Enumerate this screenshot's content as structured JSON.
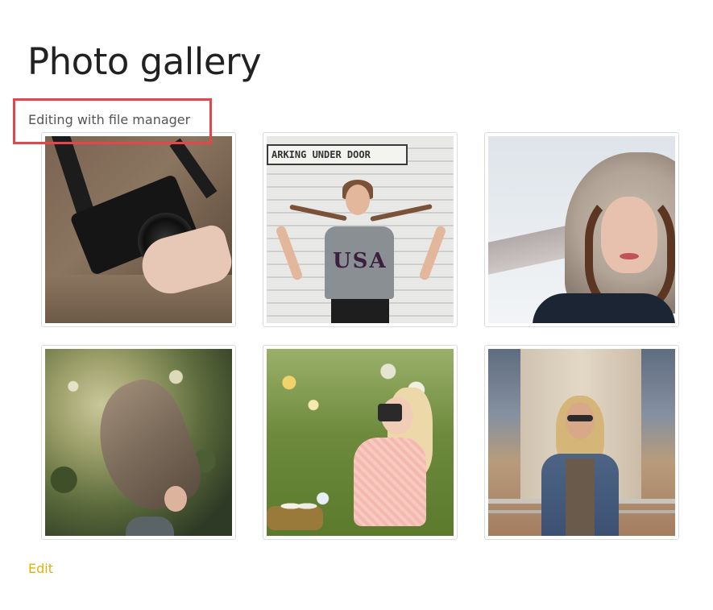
{
  "page": {
    "title": "Photo gallery",
    "subtitle": "Editing with file manager"
  },
  "gallery": {
    "photos": [
      {
        "name": "photo-camera-sweater",
        "sign_text": ""
      },
      {
        "name": "photo-usa-shirt",
        "sign_text": "ARKING UNDER DOOR",
        "shirt_text": "USA"
      },
      {
        "name": "photo-fur-hood",
        "sign_text": ""
      },
      {
        "name": "photo-hair-flip",
        "sign_text": ""
      },
      {
        "name": "photo-girl-camera",
        "sign_text": ""
      },
      {
        "name": "photo-woman-pillar",
        "sign_text": ""
      }
    ]
  },
  "actions": {
    "edit_label": "Edit"
  },
  "colors": {
    "highlight_border": "#e0484e",
    "edit_link": "#e1b10b",
    "title_text": "#222222",
    "subtitle_text": "#555555"
  }
}
